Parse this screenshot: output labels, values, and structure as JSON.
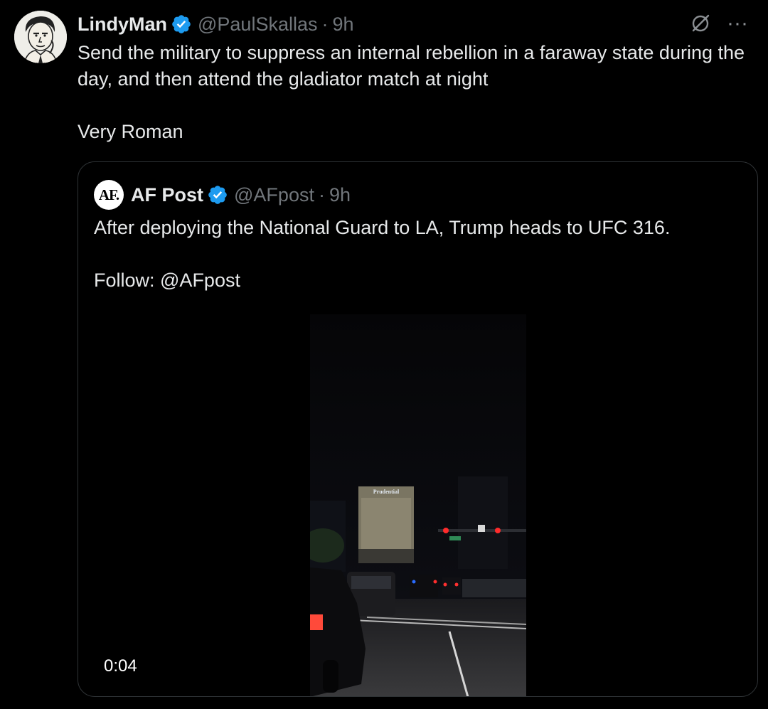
{
  "tweet": {
    "display_name": "LindyMan",
    "handle": "@PaulSkallas",
    "separator": "·",
    "time": "9h",
    "text_line1": "Send the military to suppress an internal rebellion in a faraway state during the day, and then attend the gladiator match at night",
    "text_line2": "Very Roman"
  },
  "quote": {
    "avatar_text": "AF.",
    "display_name": "AF Post",
    "handle": "@AFpost",
    "separator": "·",
    "time": "9h",
    "text_line1": "After deploying the National Guard to LA, Trump heads to UFC 316.",
    "text_line2": "Follow: @AFpost",
    "video": {
      "duration": "0:04",
      "building_sign": "Prudential"
    }
  },
  "icons": {
    "verified": "verified-badge-icon",
    "grok": "grok-icon",
    "more": "more-icon"
  },
  "colors": {
    "background": "#000000",
    "text": "#e7e9ea",
    "secondary": "#71767b",
    "verified": "#1d9bf0",
    "border": "#2f3336"
  }
}
